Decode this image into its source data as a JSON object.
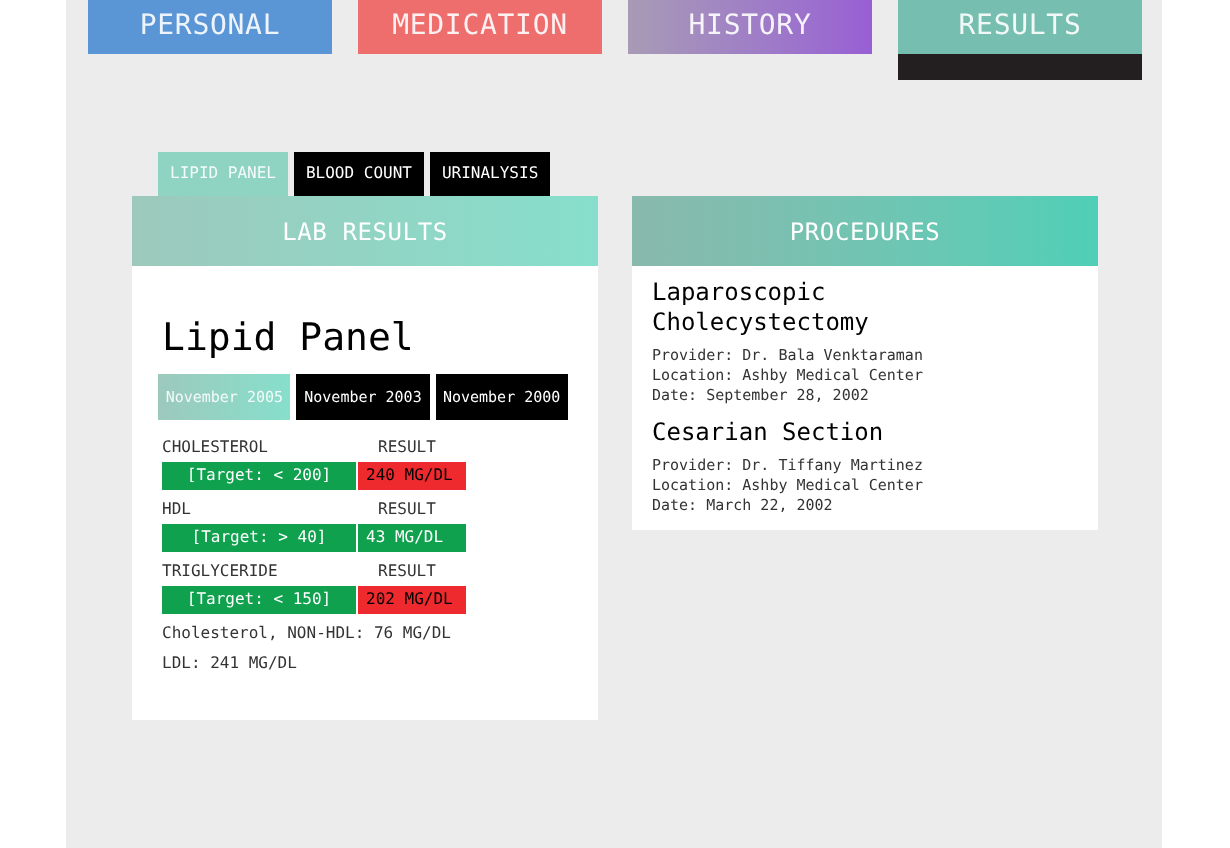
{
  "nav_tabs": [
    {
      "label": "PERSONAL",
      "selected": false
    },
    {
      "label": "MEDICATION",
      "selected": false
    },
    {
      "label": "HISTORY",
      "selected": false
    },
    {
      "label": "RESULTS",
      "selected": true
    }
  ],
  "lab_tabs": [
    {
      "label": "LIPID PANEL",
      "selected": true
    },
    {
      "label": "BLOOD COUNT",
      "selected": false
    },
    {
      "label": "URINALYSIS",
      "selected": false
    }
  ],
  "lab_results": {
    "title": "LAB RESULTS",
    "panel_title": "Lipid Panel",
    "dates": [
      {
        "label": "November 2005",
        "selected": true
      },
      {
        "label": "November 2003",
        "selected": false
      },
      {
        "label": "November 2000",
        "selected": false
      }
    ],
    "tests": [
      {
        "name": "CHOLESTEROL",
        "result_label": "RESULT",
        "target": "[Target: < 200]",
        "result": "240 MG/DL",
        "kind": "high"
      },
      {
        "name": "HDL",
        "result_label": "RESULT",
        "target": "[Target: > 40]",
        "result": "43 MG/DL",
        "kind": "normal"
      },
      {
        "name": "TRIGLYCERIDE",
        "result_label": "RESULT",
        "target": "[Target: < 150]",
        "result": "202 MG/DL",
        "kind": "high"
      }
    ],
    "notes": [
      "Cholesterol, NON-HDL: 76 MG/DL",
      "LDL: 241 MG/DL"
    ]
  },
  "procedures": {
    "title": "PROCEDURES",
    "items": [
      {
        "name": "Laparoscopic Cholecystectomy",
        "provider": "Provider: Dr. Bala Venktaraman",
        "location": "Location: Ashby Medical Center",
        "date": "Date: September 28, 2002"
      },
      {
        "name": "Cesarian Section",
        "provider": "Provider: Dr. Tiffany Martinez",
        "location": "Location: Ashby Medical Center",
        "date": "Date: March 22, 2002"
      }
    ]
  }
}
